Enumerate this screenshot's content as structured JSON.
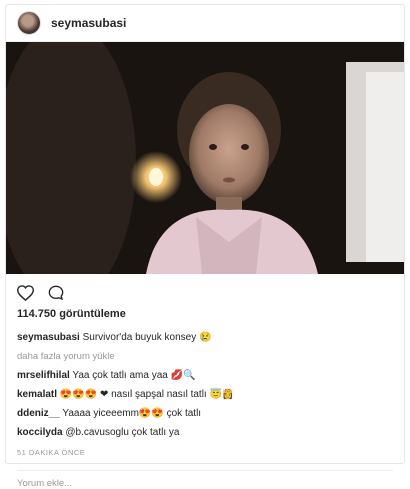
{
  "post": {
    "author": "seymasubasi",
    "views_label": "114.750 görüntüleme",
    "caption_user": "seymasubasi",
    "caption_text": "Survivor'da buyuk konsey 😢",
    "load_more": "daha fazla yorum yükle",
    "comments": [
      {
        "user": "mrselifhilal",
        "text": "Yaa çok tatlı ama yaa 💋🔍"
      },
      {
        "user": "kemalatl",
        "text": "😍😍😍 ❤ nasıl şapşal nasıl tatlı 😇👸"
      },
      {
        "user": "ddeniz__",
        "text": "Yaaaa yiceeemm😍😍 çok tatlı"
      },
      {
        "user": "koccilyda",
        "text": "@b.cavusoglu çok tatlı ya"
      }
    ],
    "timestamp": "51 DAKIKA ÖNCE",
    "add_comment_placeholder": "Yorum ekle..."
  },
  "icons": {
    "like": "heart-icon",
    "comment": "comment-icon"
  },
  "colors": {
    "text": "#262626",
    "muted": "#999999",
    "border": "#e6e6e6"
  }
}
